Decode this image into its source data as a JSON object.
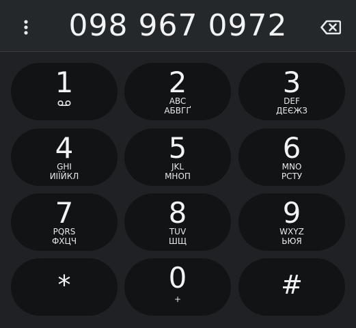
{
  "dialer": {
    "number": "098 967 0972",
    "menu_icon": "more-vert-icon",
    "backspace_icon": "backspace-icon"
  },
  "keys": [
    {
      "digit": "1",
      "letters": "",
      "letters2": "",
      "icon": "voicemail-icon"
    },
    {
      "digit": "2",
      "letters": "ABC",
      "letters2": "АБВГҐ"
    },
    {
      "digit": "3",
      "letters": "DEF",
      "letters2": "ДЕЄЖЗ"
    },
    {
      "digit": "4",
      "letters": "GHI",
      "letters2": "ИІЇЙКЛ"
    },
    {
      "digit": "5",
      "letters": "JKL",
      "letters2": "МНОП"
    },
    {
      "digit": "6",
      "letters": "MNO",
      "letters2": "РСТУ"
    },
    {
      "digit": "7",
      "letters": "PQRS",
      "letters2": "ФХЦЧ"
    },
    {
      "digit": "8",
      "letters": "TUV",
      "letters2": "ШЩ"
    },
    {
      "digit": "9",
      "letters": "WXYZ",
      "letters2": "ЬЮЯ"
    },
    {
      "digit": "*",
      "letters": "",
      "letters2": ""
    },
    {
      "digit": "0",
      "letters": "+",
      "letters2": ""
    },
    {
      "digit": "#",
      "letters": "",
      "letters2": ""
    }
  ],
  "colors": {
    "background": "#24282b",
    "key_background": "#111315",
    "text": "#f1f3f4"
  }
}
